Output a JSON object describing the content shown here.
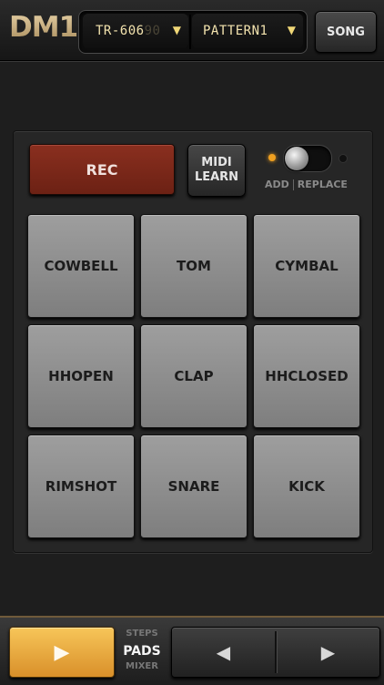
{
  "header": {
    "logo": "DM1",
    "kit_selector": {
      "value": "TR-606",
      "ghost": "90",
      "caret": "▼"
    },
    "pattern_selector": {
      "value": "PATTERN1",
      "caret": "▼"
    },
    "song_label": "SONG"
  },
  "controls": {
    "rec_label": "REC",
    "midi_learn": {
      "line1": "MIDI",
      "line2": "LEARN"
    },
    "mode": {
      "add": "ADD",
      "replace": "REPLACE",
      "selected": "ADD"
    }
  },
  "pads": [
    "COWBELL",
    "TOM",
    "CYMBAL",
    "HHOPEN",
    "CLAP",
    "HHCLOSED",
    "RIMSHOT",
    "SNARE",
    "KICK"
  ],
  "transport": {
    "play_icon": "▶",
    "views": {
      "steps": "STEPS",
      "pads": "PADS",
      "mixer": "MIXER",
      "selected": "PADS"
    },
    "prev_icon": "◀",
    "next_icon": "▶"
  },
  "colors": {
    "rec": "#7a2818",
    "play": "#e9a840",
    "pad": "#8e8e8e",
    "lcd_text": "#f3e3ae",
    "led_on": "#f0a020"
  }
}
